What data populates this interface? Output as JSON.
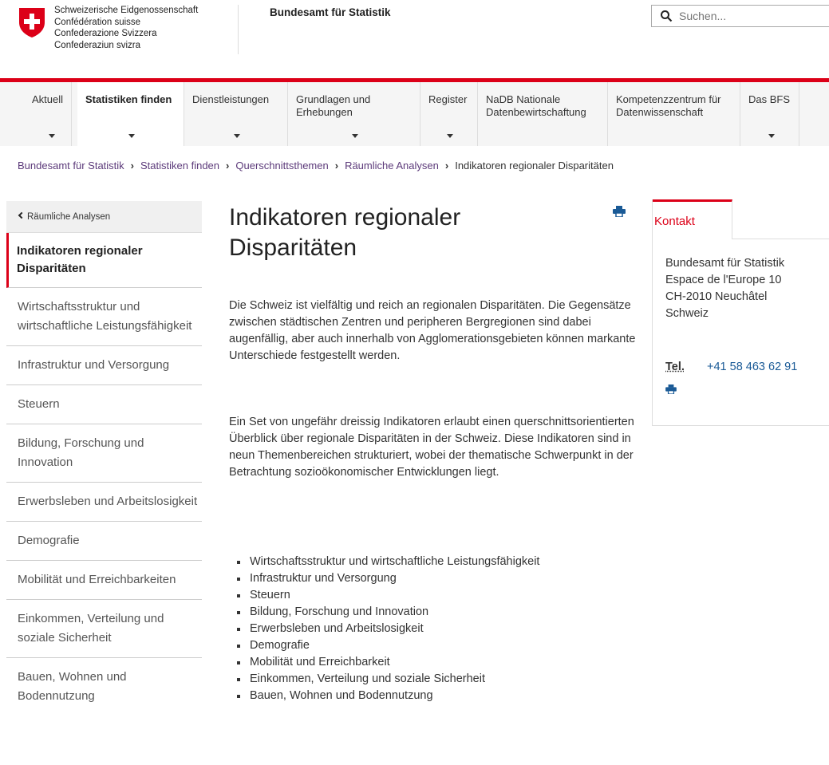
{
  "header": {
    "gov_names": [
      "Schweizerische Eidgenossenschaft",
      "Confédération suisse",
      "Confederazione Svizzera",
      "Confederaziun svizra"
    ],
    "agency": "Bundesamt für Statistik",
    "search_placeholder": "Suchen..."
  },
  "nav": {
    "items": [
      {
        "label": "Aktuell"
      },
      {
        "label": "Statistiken finden"
      },
      {
        "label": "Dienstleistungen"
      },
      {
        "label": "Grundlagen und Erhebungen"
      },
      {
        "label": "Register"
      },
      {
        "label": "NaDB Nationale Datenbewirtschaftung"
      },
      {
        "label": "Kompetenzzentrum für Datenwissenschaft"
      },
      {
        "label": "Das BFS"
      }
    ]
  },
  "breadcrumb": {
    "items": [
      "Bundesamt für Statistik",
      "Statistiken finden",
      "Querschnittsthemen",
      "Räumliche Analysen"
    ],
    "current": "Indikatoren regionaler Disparitäten"
  },
  "sidebar": {
    "back_label": "Räumliche Analysen",
    "active": "Indikatoren regionaler Disparitäten",
    "items": [
      "Wirtschaftsstruktur und wirtschaftliche Leistungsfähigkeit",
      "Infrastruktur und Versorgung",
      "Steuern",
      "Bildung, Forschung und Innovation",
      "Erwerbsleben und Arbeitslosigkeit",
      "Demografie",
      "Mobilität und Erreichbarkeiten",
      "Einkommen, Verteilung und soziale Sicherheit",
      "Bauen, Wohnen und Bodennutzung"
    ]
  },
  "main": {
    "title": "Indikatoren regionaler Disparitäten",
    "paragraph1": "Die Schweiz ist vielfältig und reich an regionalen Disparitäten. Die Gegensätze zwischen städtischen Zentren und peripheren Bergregionen sind dabei augenfällig, aber auch innerhalb von Agglomerationsgebieten können markante Unterschiede festgestellt werden.",
    "paragraph2": "Ein Set von ungefähr dreissig Indikatoren erlaubt einen querschnittsorientierten Überblick über regionale Disparitäten in der Schweiz. Diese Indikatoren sind in neun Themenbereichen strukturiert, wobei der thematische Schwerpunkt in der Betrachtung sozioökonomischer Entwicklungen liegt.",
    "topics": [
      "Wirtschaftsstruktur und wirtschaftliche Leistungsfähigkeit",
      "Infrastruktur und Versorgung",
      "Steuern",
      "Bildung, Forschung und Innovation",
      "Erwerbsleben und Arbeitslosigkeit",
      "Demografie",
      "Mobilität und Erreichbarkeit",
      "Einkommen, Verteilung und soziale Sicherheit",
      "Bauen, Wohnen und Bodennutzung"
    ]
  },
  "contact": {
    "tab_label": "Kontakt",
    "address": [
      "Bundesamt für Statistik",
      "Espace de l'Europe 10",
      "CH-2010 Neuchâtel",
      "Schweiz"
    ],
    "tel_label": "Tel.",
    "tel_number": "+41 58 463 62 91"
  },
  "colors": {
    "accent_red": "#dc0018",
    "link_purple": "#5c3a7a",
    "link_blue": "#1a5a96"
  },
  "icons": [
    "swiss-coat-of-arms-icon",
    "search-icon",
    "chevron-down-icon",
    "chevron-left-icon",
    "printer-icon"
  ]
}
